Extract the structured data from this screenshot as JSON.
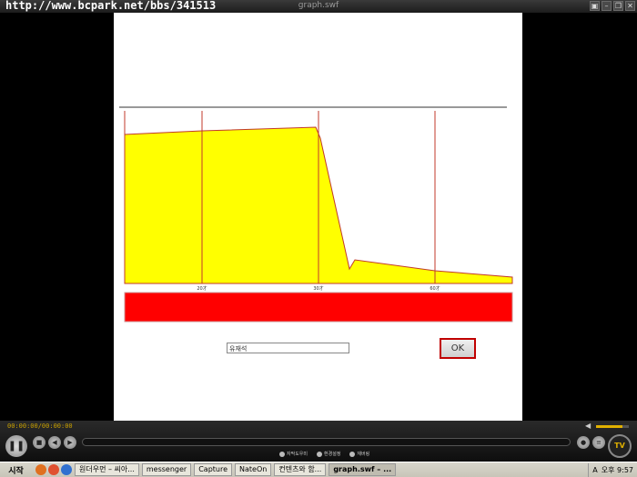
{
  "titlebar": {
    "url_text": "http://www.bcpark.net/bbs/341513",
    "window_title": "graph.swf",
    "buttons": [
      "▣",
      "–",
      "❐",
      "✕"
    ]
  },
  "graph": {
    "x_labels": [
      "20才",
      "30才",
      "60才"
    ],
    "fill_color": "#ffff00",
    "bar_color": "#ff0000",
    "line_color": "#c0392b"
  },
  "form": {
    "name_value": "유재석",
    "ok_label": "OK"
  },
  "player": {
    "timecode": "00:00:00/00:00:00",
    "pause_symbol": "❚❚",
    "links": [
      "자막도우미",
      "환경설정",
      "재버링"
    ],
    "logo_text": "TV",
    "volume_level": 0.8
  },
  "taskbar": {
    "start_label": "시작",
    "tasks": [
      {
        "label": "원더우먼 – 씨아...",
        "active": false
      },
      {
        "label": "messenger",
        "active": false
      },
      {
        "label": "Capture",
        "active": false
      },
      {
        "label": "NateOn",
        "active": false
      },
      {
        "label": "컨텐츠와 함...",
        "active": false
      },
      {
        "label": "graph.swf – ...",
        "active": true
      }
    ],
    "lang": "A",
    "clock": "오후 9:57"
  }
}
